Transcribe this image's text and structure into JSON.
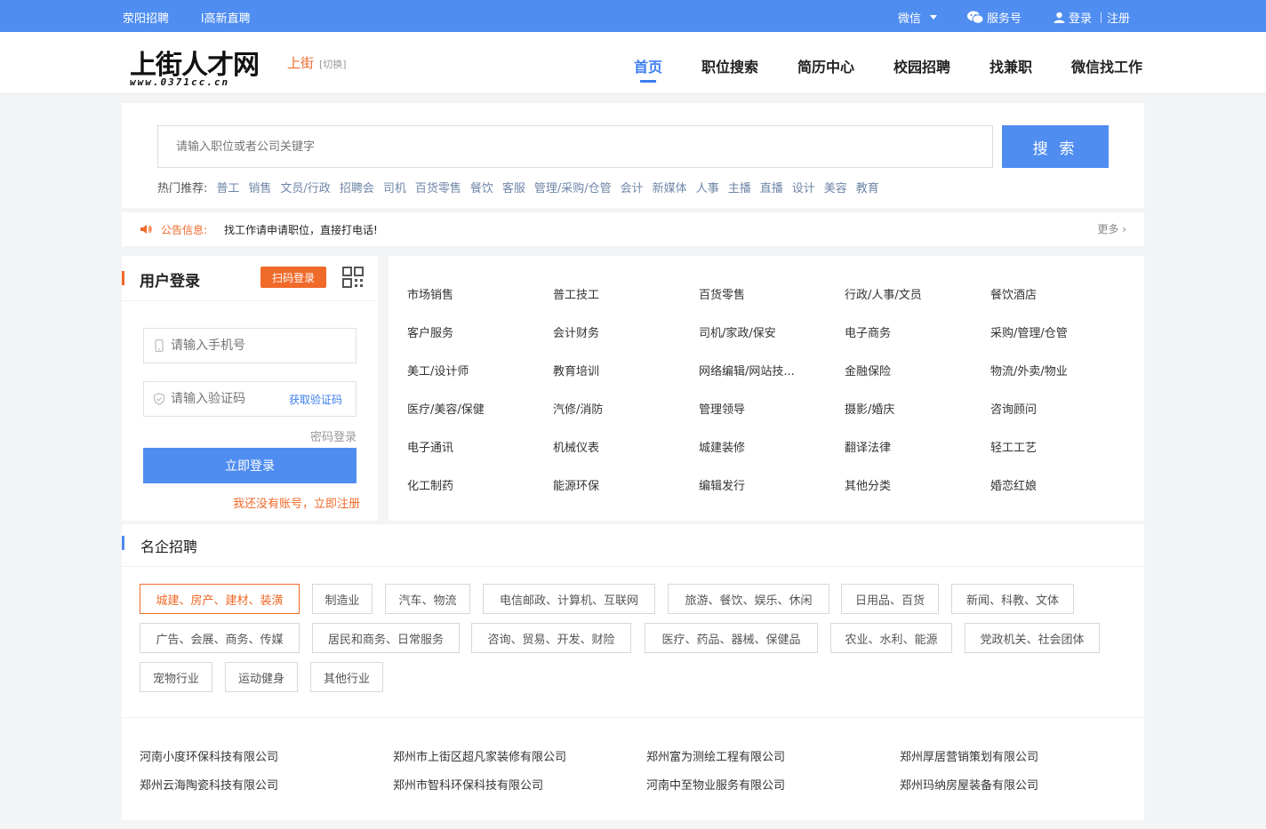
{
  "topbar": {
    "links": [
      "荥阳招聘",
      "l高新直聘"
    ],
    "wechat": "微信",
    "service": "服务号",
    "login": "登录",
    "register": "注册"
  },
  "header": {
    "logo_text": "上街人才网",
    "logo_url_text": "www.0371cc.cn",
    "city": "上街",
    "city_switch": "[切换]",
    "nav": [
      "首页",
      "职位搜索",
      "简历中心",
      "校园招聘",
      "找兼职",
      "微信找工作"
    ],
    "active_nav": "首页"
  },
  "search": {
    "placeholder": "请输入职位或者公司关键字",
    "button": "搜 索",
    "hot_label": "热门推荐:",
    "hot": [
      "普工",
      "销售",
      "文员/行政",
      "招聘会",
      "司机",
      "百货零售",
      "餐饮",
      "客服",
      "管理/采购/仓管",
      "会计",
      "新媒体",
      "人事",
      "主播",
      "直播",
      "设计",
      "美容",
      "教育"
    ]
  },
  "notice": {
    "label": "公告信息:",
    "text": "找工作请申请职位，直接打电话!",
    "more": "更多 ›"
  },
  "login": {
    "title": "用户登录",
    "qr_tag": "扫码登录",
    "phone_placeholder": "请输入手机号",
    "code_placeholder": "请输入验证码",
    "get_code": "获取验证码",
    "password_login": "密码登录",
    "submit": "立即登录",
    "register": "我还没有账号，立即注册"
  },
  "categories": [
    [
      "市场销售",
      "普工技工",
      "百货零售",
      "行政/人事/文员",
      "餐饮酒店"
    ],
    [
      "客户服务",
      "会计财务",
      "司机/家政/保安",
      "电子商务",
      "采购/管理/仓管"
    ],
    [
      "美工/设计师",
      "教育培训",
      "网络编辑/网站技...",
      "金融保险",
      "物流/外卖/物业"
    ],
    [
      "医疗/美容/保健",
      "汽修/消防",
      "管理领导",
      "摄影/婚庆",
      "咨询顾问"
    ],
    [
      "电子通讯",
      "机械仪表",
      "城建装修",
      "翻译法律",
      "轻工工艺"
    ],
    [
      "化工制药",
      "能源环保",
      "编辑发行",
      "其他分类",
      "婚恋红娘"
    ]
  ],
  "famous": {
    "title": "名企招聘",
    "tags": [
      "城建、房产、建材、装潢",
      "制造业",
      "汽车、物流",
      "电信邮政、计算机、互联网",
      "旅游、餐饮、娱乐、休闲",
      "日用品、百货",
      "新闻、科教、文体",
      "广告、会展、商务、传媒",
      "居民和商务、日常服务",
      "咨询、贸易、开发、财险",
      "医疗、药品、器械、保健品",
      "农业、水利、能源",
      "党政机关、社会团体",
      "宠物行业",
      "运动健身",
      "其他行业"
    ],
    "active_tag": "城建、房产、建材、装潢",
    "companies": [
      "河南小度环保科技有限公司",
      "郑州市上街区超凡家装修有限公司",
      "郑州富为测绘工程有限公司",
      "郑州厚居营销策划有限公司",
      "郑州云海陶瓷科技有限公司",
      "郑州市智科环保科技有限公司",
      "河南中至物业服务有限公司",
      "郑州玛纳房屋装备有限公司"
    ]
  },
  "colors": {
    "brand_blue": "#4f8df0",
    "accent_orange": "#f06a2a"
  }
}
